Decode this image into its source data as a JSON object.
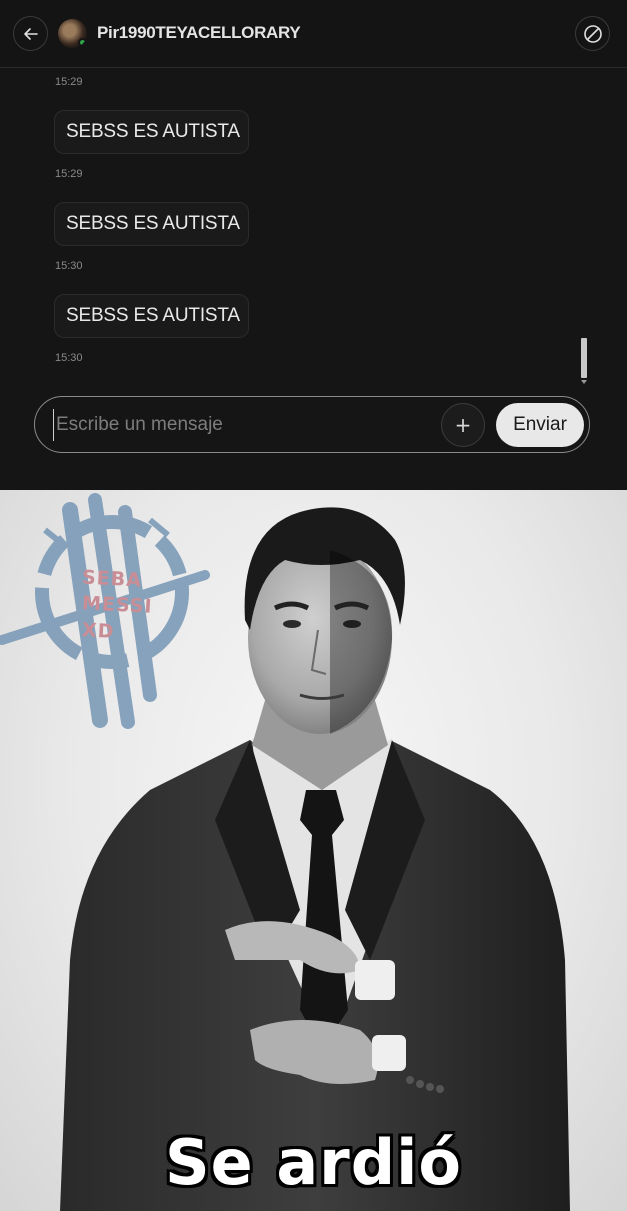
{
  "header": {
    "username": "Pir1990TEYACELLORARY",
    "back_icon": "arrow-left-icon",
    "block_icon": "block-icon"
  },
  "messages": [
    {
      "time": "15:29",
      "text": ""
    },
    {
      "time": "15:29",
      "text": "SEBSS ES AUTISTA"
    },
    {
      "time": "15:30",
      "text": "SEBSS ES AUTISTA"
    },
    {
      "time": "15:30",
      "text": "SEBSS ES AUTISTA"
    }
  ],
  "timestamps": [
    "15:29",
    "15:29",
    "15:30",
    "15:30"
  ],
  "bubbles": [
    "SEBSS ES AUTISTA",
    "SEBSS ES AUTISTA",
    "SEBSS ES AUTISTA"
  ],
  "composer": {
    "placeholder": "Escribe un mensaje",
    "value": "",
    "plus_label": "+",
    "send_label": "Enviar"
  },
  "meme": {
    "logo_lines": [
      "SEBA",
      "MESSI",
      "XD"
    ],
    "caption": "Se ardió"
  },
  "colors": {
    "background": "#151515",
    "accent_button": "#e8e8e8",
    "logo_blue": "#7f9cb8",
    "logo_text": "#c98d95"
  }
}
